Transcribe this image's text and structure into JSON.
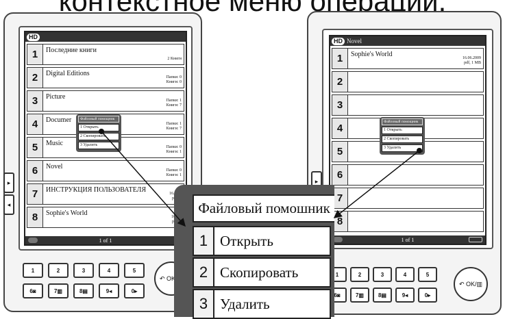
{
  "title": "контекстное меню операций.",
  "left_device": {
    "hd": "HD",
    "header_title": "",
    "rows": [
      {
        "num": "1",
        "title": "Последние книги",
        "meta": [
          "2 Книги"
        ]
      },
      {
        "num": "2",
        "title": "Digital Editions",
        "meta": [
          "Папки: 0",
          "Книги: 0"
        ]
      },
      {
        "num": "3",
        "title": "Picture",
        "meta": [
          "Папки: 1",
          "Книги: 7"
        ]
      },
      {
        "num": "4",
        "title": "Documer",
        "meta": [
          "Папки: 1",
          "Книги: 7"
        ]
      },
      {
        "num": "5",
        "title": "Music",
        "meta": [
          "Папки: 0",
          "Книги: 1"
        ]
      },
      {
        "num": "6",
        "title": "Novel",
        "meta": [
          "Папки: 0",
          "Книги: 1"
        ]
      },
      {
        "num": "7",
        "title": "ИНСТРУКЦИЯ ПОЛЬЗОВАТЕЛЯ",
        "meta": [
          "16.06.2",
          "pdf, 1"
        ]
      },
      {
        "num": "8",
        "title": "Sophie's World",
        "meta": [
          "16.06.",
          "pdf, 1"
        ]
      }
    ],
    "footer": "1 of 1",
    "popup": {
      "head": "Файловый помощник",
      "items": [
        {
          "n": "1",
          "label": "Открыть"
        },
        {
          "n": "2",
          "label": "Скопировать"
        },
        {
          "n": "3",
          "label": "Удалить"
        }
      ]
    }
  },
  "right_device": {
    "hd": "HD",
    "header_title": "Novel",
    "rows": [
      {
        "num": "1",
        "title": "Sophie's World",
        "meta": [
          "16.06.2009",
          "pdf, 1 MB"
        ]
      },
      {
        "num": "2",
        "title": "",
        "meta": []
      },
      {
        "num": "3",
        "title": "",
        "meta": []
      },
      {
        "num": "4",
        "title": "",
        "meta": []
      },
      {
        "num": "5",
        "title": "",
        "meta": []
      },
      {
        "num": "6",
        "title": "",
        "meta": []
      },
      {
        "num": "7",
        "title": "",
        "meta": []
      },
      {
        "num": "8",
        "title": "",
        "meta": []
      }
    ],
    "footer": "1 of 1",
    "popup": {
      "head": "Файловый помощник",
      "items": [
        {
          "n": "1",
          "label": "Открыть"
        },
        {
          "n": "2",
          "label": "Скопировать"
        },
        {
          "n": "3",
          "label": "Удалить"
        }
      ]
    }
  },
  "keypad": {
    "row1": [
      "1",
      "2",
      "3",
      "4",
      "5"
    ],
    "row2": [
      "6◙",
      "7▥",
      "8▤",
      "9◂",
      "0▸"
    ],
    "ok": "↶ OK/▥"
  },
  "big_popup": {
    "head": "Файловый помошник",
    "items": [
      {
        "n": "1",
        "label": "Открыть"
      },
      {
        "n": "2",
        "label": "Скопировать"
      },
      {
        "n": "3",
        "label": "Удалить"
      }
    ]
  },
  "colors": {
    "popup_bg": "#555555",
    "header_bg": "#333333",
    "border": "#222222"
  }
}
